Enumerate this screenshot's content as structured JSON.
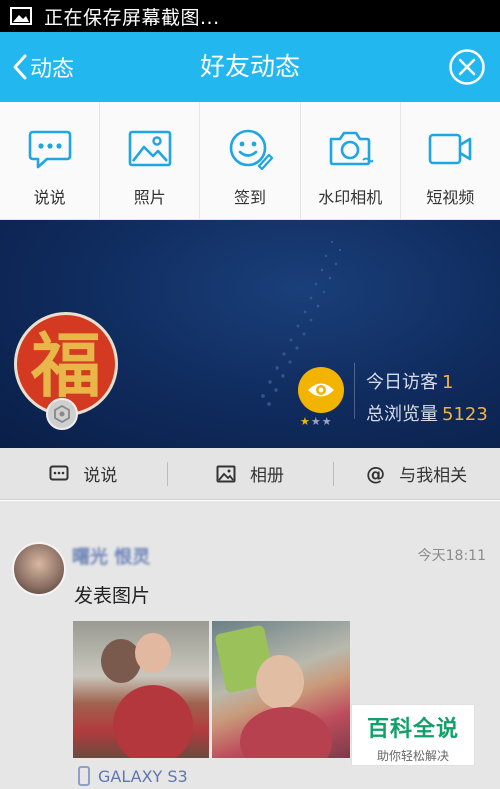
{
  "status_bar": {
    "icon": "image-icon",
    "text": "正在保存屏幕截图..."
  },
  "nav": {
    "back_label": "动态",
    "title": "好友动态",
    "close_icon": "close-circle-icon"
  },
  "colors": {
    "nav_bg": "#22b7ef",
    "accent_gold": "#f2b400",
    "cover_bg": "#0f2a5c",
    "watermark_green": "#12a06a"
  },
  "quick_actions": [
    {
      "label": "说说",
      "icon": "speech-bubble-icon"
    },
    {
      "label": "照片",
      "icon": "photo-icon"
    },
    {
      "label": "签到",
      "icon": "smile-checkin-icon"
    },
    {
      "label": "水印相机",
      "icon": "camera-icon"
    },
    {
      "label": "短视频",
      "icon": "video-camera-icon"
    }
  ],
  "profile": {
    "avatar_text": "福",
    "stats": [
      {
        "label": "今日访客",
        "value": "1"
      },
      {
        "label": "总浏览量",
        "value": "5123"
      }
    ],
    "level_stars": 3
  },
  "tabs": [
    {
      "label": "说说",
      "icon": "speech-bubble-icon"
    },
    {
      "label": "相册",
      "icon": "album-icon"
    },
    {
      "label": "与我相关",
      "icon": "at-sign-icon",
      "prefix": "@"
    }
  ],
  "feed_item": {
    "user_name": "曙光 恨灵",
    "time": "今天18:11",
    "text": "发表图片",
    "device": "GALAXY S3"
  },
  "watermark": {
    "main": "百科全说",
    "sub": "助你轻松解决"
  }
}
